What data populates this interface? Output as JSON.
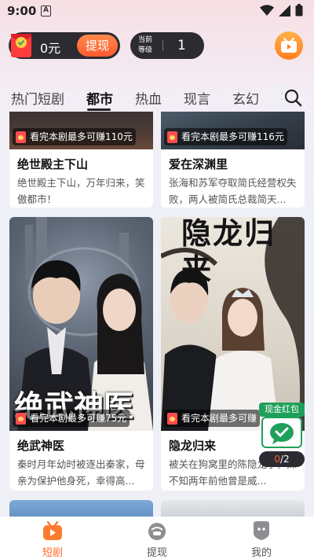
{
  "status_bar": {
    "time": "9:00",
    "notification_letter": "A"
  },
  "header": {
    "coin_value": "0元",
    "withdraw_label": "提现",
    "level_label": "当前等级",
    "level_value": "1"
  },
  "tabs": [
    {
      "label": "热门短剧",
      "active": false
    },
    {
      "label": "都市",
      "active": true
    },
    {
      "label": "热血",
      "active": false
    },
    {
      "label": "现言",
      "active": false
    },
    {
      "label": "玄幻",
      "active": false
    },
    {
      "label": ":",
      "active": false
    }
  ],
  "cards": [
    {
      "earn_tag": "看完本剧最多可赚110元",
      "title": "绝世殿主下山",
      "description": "绝世殿主下山，万年归来，笑傲都市！"
    },
    {
      "earn_tag": "看完本剧最多可赚116元",
      "title": "爱在深渊里",
      "description": "张海和苏军夺取简氏经营权失败，两人被简氏总裁简天..."
    },
    {
      "earn_tag": "看完本剧最多可赚75元",
      "title": "绝武神医",
      "description": "秦时月年幼时被逐出秦家，母亲为保护他身死，幸得高...",
      "poster_text": "绝武神医"
    },
    {
      "earn_tag": "看完本剧最多可赚",
      "title": "隐龙归来",
      "description": "被关在狗窝里的陈隐龙子，殊不知两年前他曾是威...",
      "poster_text": "隐龙归来"
    }
  ],
  "float_packet": {
    "label": "现金红包",
    "progress_current": "0",
    "progress_total": "/2"
  },
  "bottom_nav": [
    {
      "label": "短剧",
      "icon": "play-tv-icon",
      "active": true
    },
    {
      "label": "提现",
      "icon": "wallet-icon",
      "active": false
    },
    {
      "label": "我的",
      "icon": "profile-icon",
      "active": false
    }
  ],
  "colors": {
    "accent": "#ff6a2a",
    "pill_bg": "#2d2b32",
    "green": "#1fa05a"
  }
}
